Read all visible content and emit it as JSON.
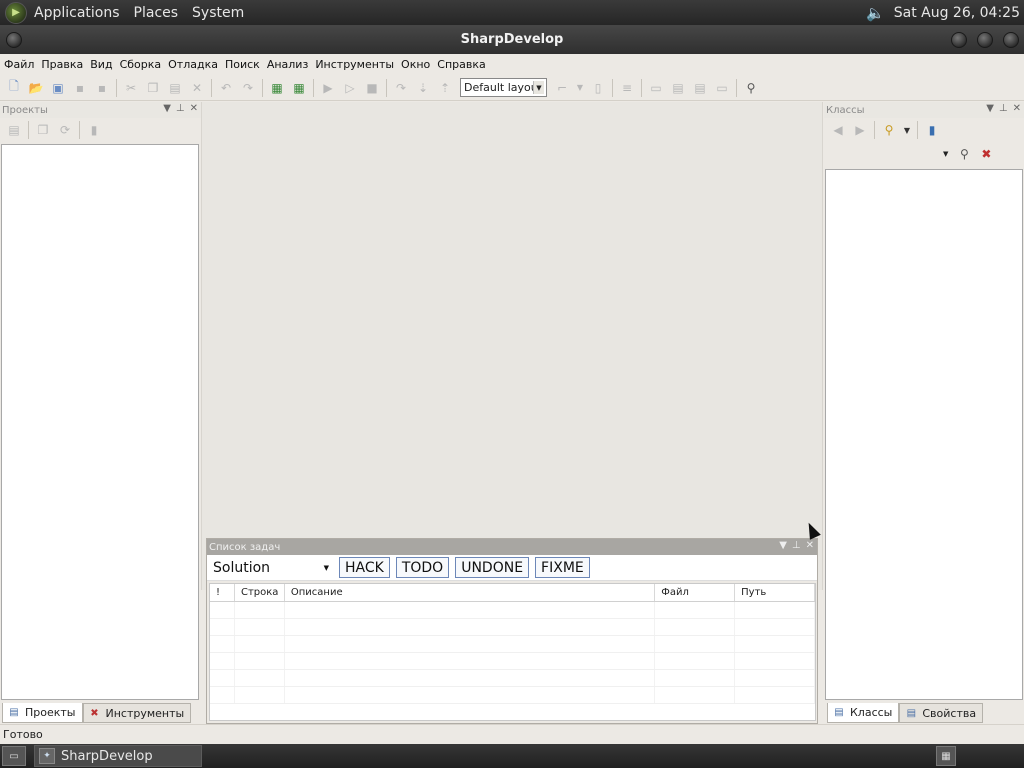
{
  "top_panel": {
    "menus": [
      "Applications",
      "Places",
      "System"
    ],
    "clock": "Sat Aug 26, 04:25"
  },
  "window": {
    "title": "SharpDevelop"
  },
  "menubar": {
    "items": [
      "Файл",
      "Правка",
      "Вид",
      "Сборка",
      "Отладка",
      "Поиск",
      "Анализ",
      "Инструменты",
      "Окно",
      "Справка"
    ]
  },
  "toolbar": {
    "layout_value": "Default layout"
  },
  "projects_pad": {
    "title": "Проекты",
    "tabs": [
      "Проекты",
      "Инструменты"
    ]
  },
  "classes_pad": {
    "title": "Классы",
    "tabs": [
      "Классы",
      "Свойства"
    ]
  },
  "task_list": {
    "title": "Список задач",
    "scope": "Solution",
    "tags": [
      "HACK",
      "TODO",
      "UNDONE",
      "FIXME"
    ],
    "columns": [
      "!",
      "Строка",
      "Описание",
      "Файл",
      "Путь"
    ]
  },
  "statusbar": {
    "text": "Готово"
  },
  "bottom_panel": {
    "task": "SharpDevelop"
  },
  "colors": {
    "panel_bg": "#262626",
    "app_bg": "#ece9e4",
    "tag_border": "#6c87b8"
  }
}
